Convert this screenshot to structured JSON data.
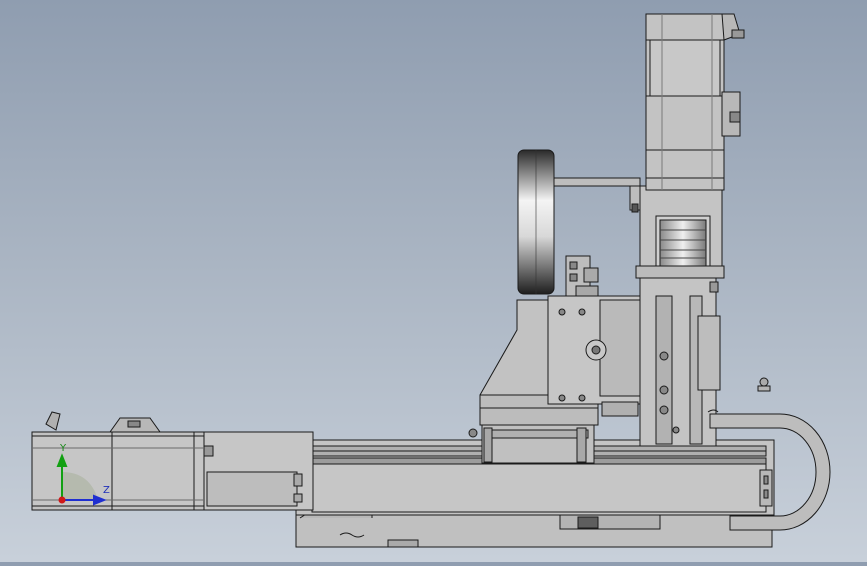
{
  "view": {
    "type": "cad-side-view",
    "background_top": "#8f9db0",
    "background_bottom": "#c8d0da",
    "part_fill": "#c0c0c0",
    "part_fill_dark": "#a8a8a8",
    "part_stroke": "#1a1a1a"
  },
  "triad": {
    "y_label": "Y",
    "z_label": "Z",
    "y_color": "#12a012",
    "z_color": "#1f2fd0",
    "x_color": "#d01818"
  }
}
